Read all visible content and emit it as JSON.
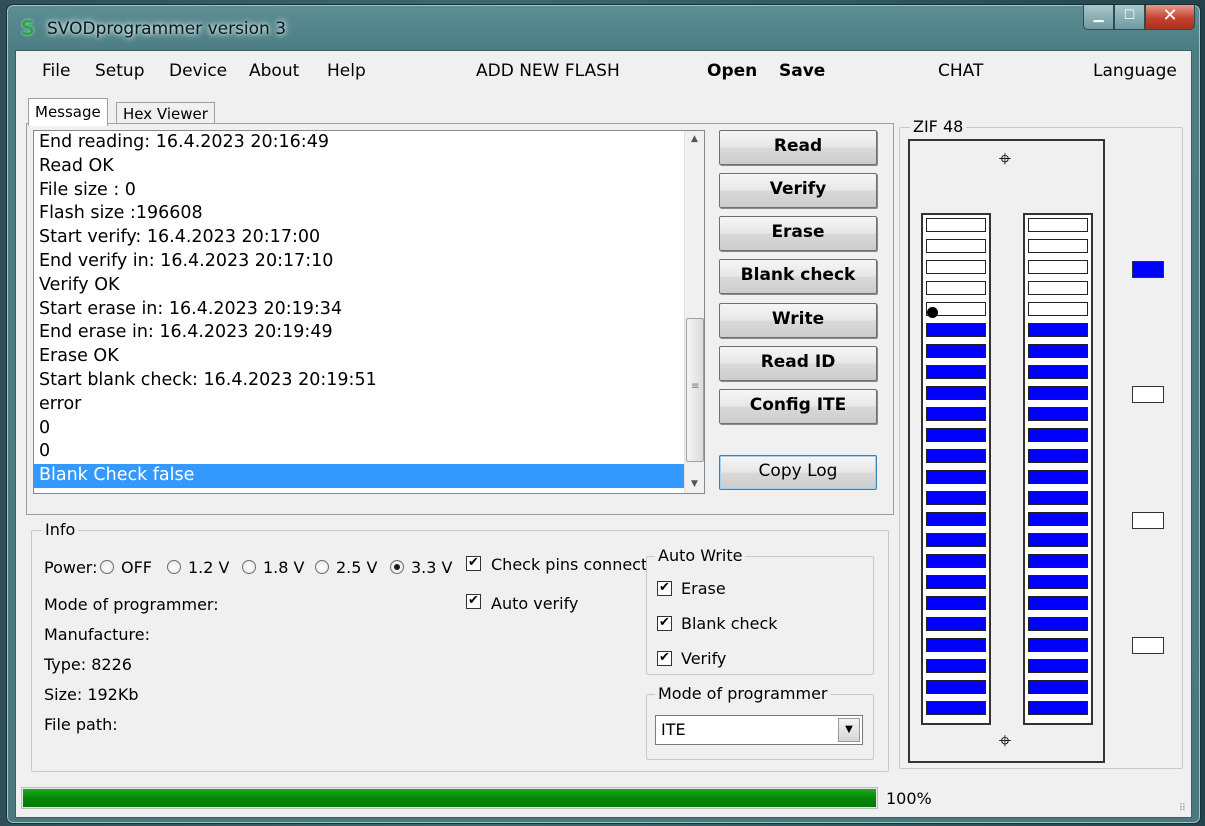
{
  "window": {
    "title": "SVODprogrammer version 3"
  },
  "menu": [
    {
      "label": "File",
      "bold": false
    },
    {
      "label": "Setup",
      "bold": false
    },
    {
      "label": "Device",
      "bold": false
    },
    {
      "label": "About",
      "bold": false
    },
    {
      "label": "Help",
      "bold": false
    },
    {
      "label": "ADD NEW FLASH",
      "bold": false
    },
    {
      "label": "Open",
      "bold": true
    },
    {
      "label": "Save",
      "bold": true
    },
    {
      "label": "CHAT",
      "bold": false
    },
    {
      "label": "Language",
      "bold": false
    }
  ],
  "tabs": [
    {
      "label": "Message",
      "active": true
    },
    {
      "label": "Hex Viewer",
      "active": false
    }
  ],
  "log": {
    "lines": [
      "End reading: 16.4.2023 20:16:49",
      "Read OK",
      "File size : 0",
      "Flash size :196608",
      "Start verify: 16.4.2023 20:17:00",
      "End verify in: 16.4.2023 20:17:10",
      "Verify OK",
      "Start erase in: 16.4.2023 20:19:34",
      "End erase in: 16.4.2023 20:19:49",
      "Erase OK",
      "Start blank check: 16.4.2023 20:19:51",
      "error",
      "0",
      "0",
      "Blank Check false"
    ],
    "selected_index": 14
  },
  "actions": {
    "read": "Read",
    "verify": "Verify",
    "erase": "Erase",
    "blank_check": "Blank check",
    "write": "Write",
    "read_id": "Read ID",
    "config_ite": "Config ITE",
    "copy_log": "Copy Log"
  },
  "info": {
    "legend": "Info",
    "power_label": "Power:",
    "power_options": [
      "OFF",
      "1.2 V",
      "1.8 V",
      "2.5 V",
      "3.3 V"
    ],
    "power_selected": 4,
    "mode_label": "Mode of programmer:",
    "manufacture_label": "Manufacture:",
    "type_label": "Type: 8226",
    "size_label": "Size: 192Kb",
    "file_path_label": "File path:",
    "check_pins": {
      "label": "Check pins connect",
      "checked": true
    },
    "auto_verify": {
      "label": "Auto verify",
      "checked": true
    },
    "auto_write": {
      "legend": "Auto Write",
      "erase": {
        "label": "Erase",
        "checked": true
      },
      "blank_check": {
        "label": "Blank check",
        "checked": true
      },
      "verify": {
        "label": "Verify",
        "checked": true
      }
    },
    "mode_group": {
      "legend": "Mode of programmer",
      "selected": "ITE"
    }
  },
  "zif": {
    "legend": "ZIF 48",
    "pins_per_side": 24,
    "first_active_pin": 5,
    "indicators": [
      true,
      false,
      false,
      false
    ]
  },
  "status": {
    "progress": 100,
    "progress_text": "100%"
  },
  "colors": {
    "pin_active": "#0000ff",
    "progress": "#068806",
    "selection": "#3399ff"
  },
  "icons": {
    "crosshair": "⌖",
    "check": "✔"
  }
}
